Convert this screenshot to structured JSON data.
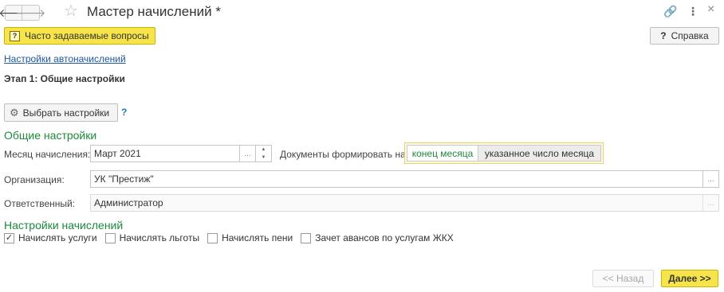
{
  "header": {
    "title": "Мастер начислений *",
    "back_glyph": "🡐",
    "forward_glyph": "🡒",
    "star_glyph": "☆",
    "link_glyph": "🔗",
    "more_glyph": "⋮",
    "close_glyph": "×"
  },
  "toolbar": {
    "faq_icon": "?",
    "faq_label": "Часто задаваемые вопросы",
    "help_icon": "?",
    "help_label": "Справка"
  },
  "settings_link": "Настройки автоначислений",
  "stage_title": "Этап 1: Общие настройки",
  "choose_settings": {
    "label": "Выбрать настройки",
    "hint": "?"
  },
  "general": {
    "section_title": "Общие настройки",
    "month_label": "Месяц начисления:",
    "month_value": "Март 2021",
    "ellipsis": "...",
    "docs_label": "Документы формировать на:",
    "docs_options": [
      "конец месяца",
      "указанное число месяца"
    ],
    "docs_selected": "конец месяца",
    "org_label": "Организация:",
    "org_value": "УК \"Престиж\"",
    "resp_label": "Ответственный:",
    "resp_value": "Администратор"
  },
  "accrual": {
    "section_title": "Настройки начислений",
    "checkboxes": [
      {
        "label": "Начислять услуги",
        "checked": true
      },
      {
        "label": "Начислять льготы",
        "checked": false
      },
      {
        "label": "Начислять пени",
        "checked": false
      },
      {
        "label": "Зачет авансов по услугам ЖКХ",
        "checked": false
      }
    ],
    "check_mark": "✓"
  },
  "footer": {
    "back_label": "<< Назад",
    "next_label": "Далее >>"
  },
  "colors": {
    "accent_yellow": "#f6e44a",
    "section_green": "#1c8a3a",
    "link_blue": "#1e56a0"
  }
}
